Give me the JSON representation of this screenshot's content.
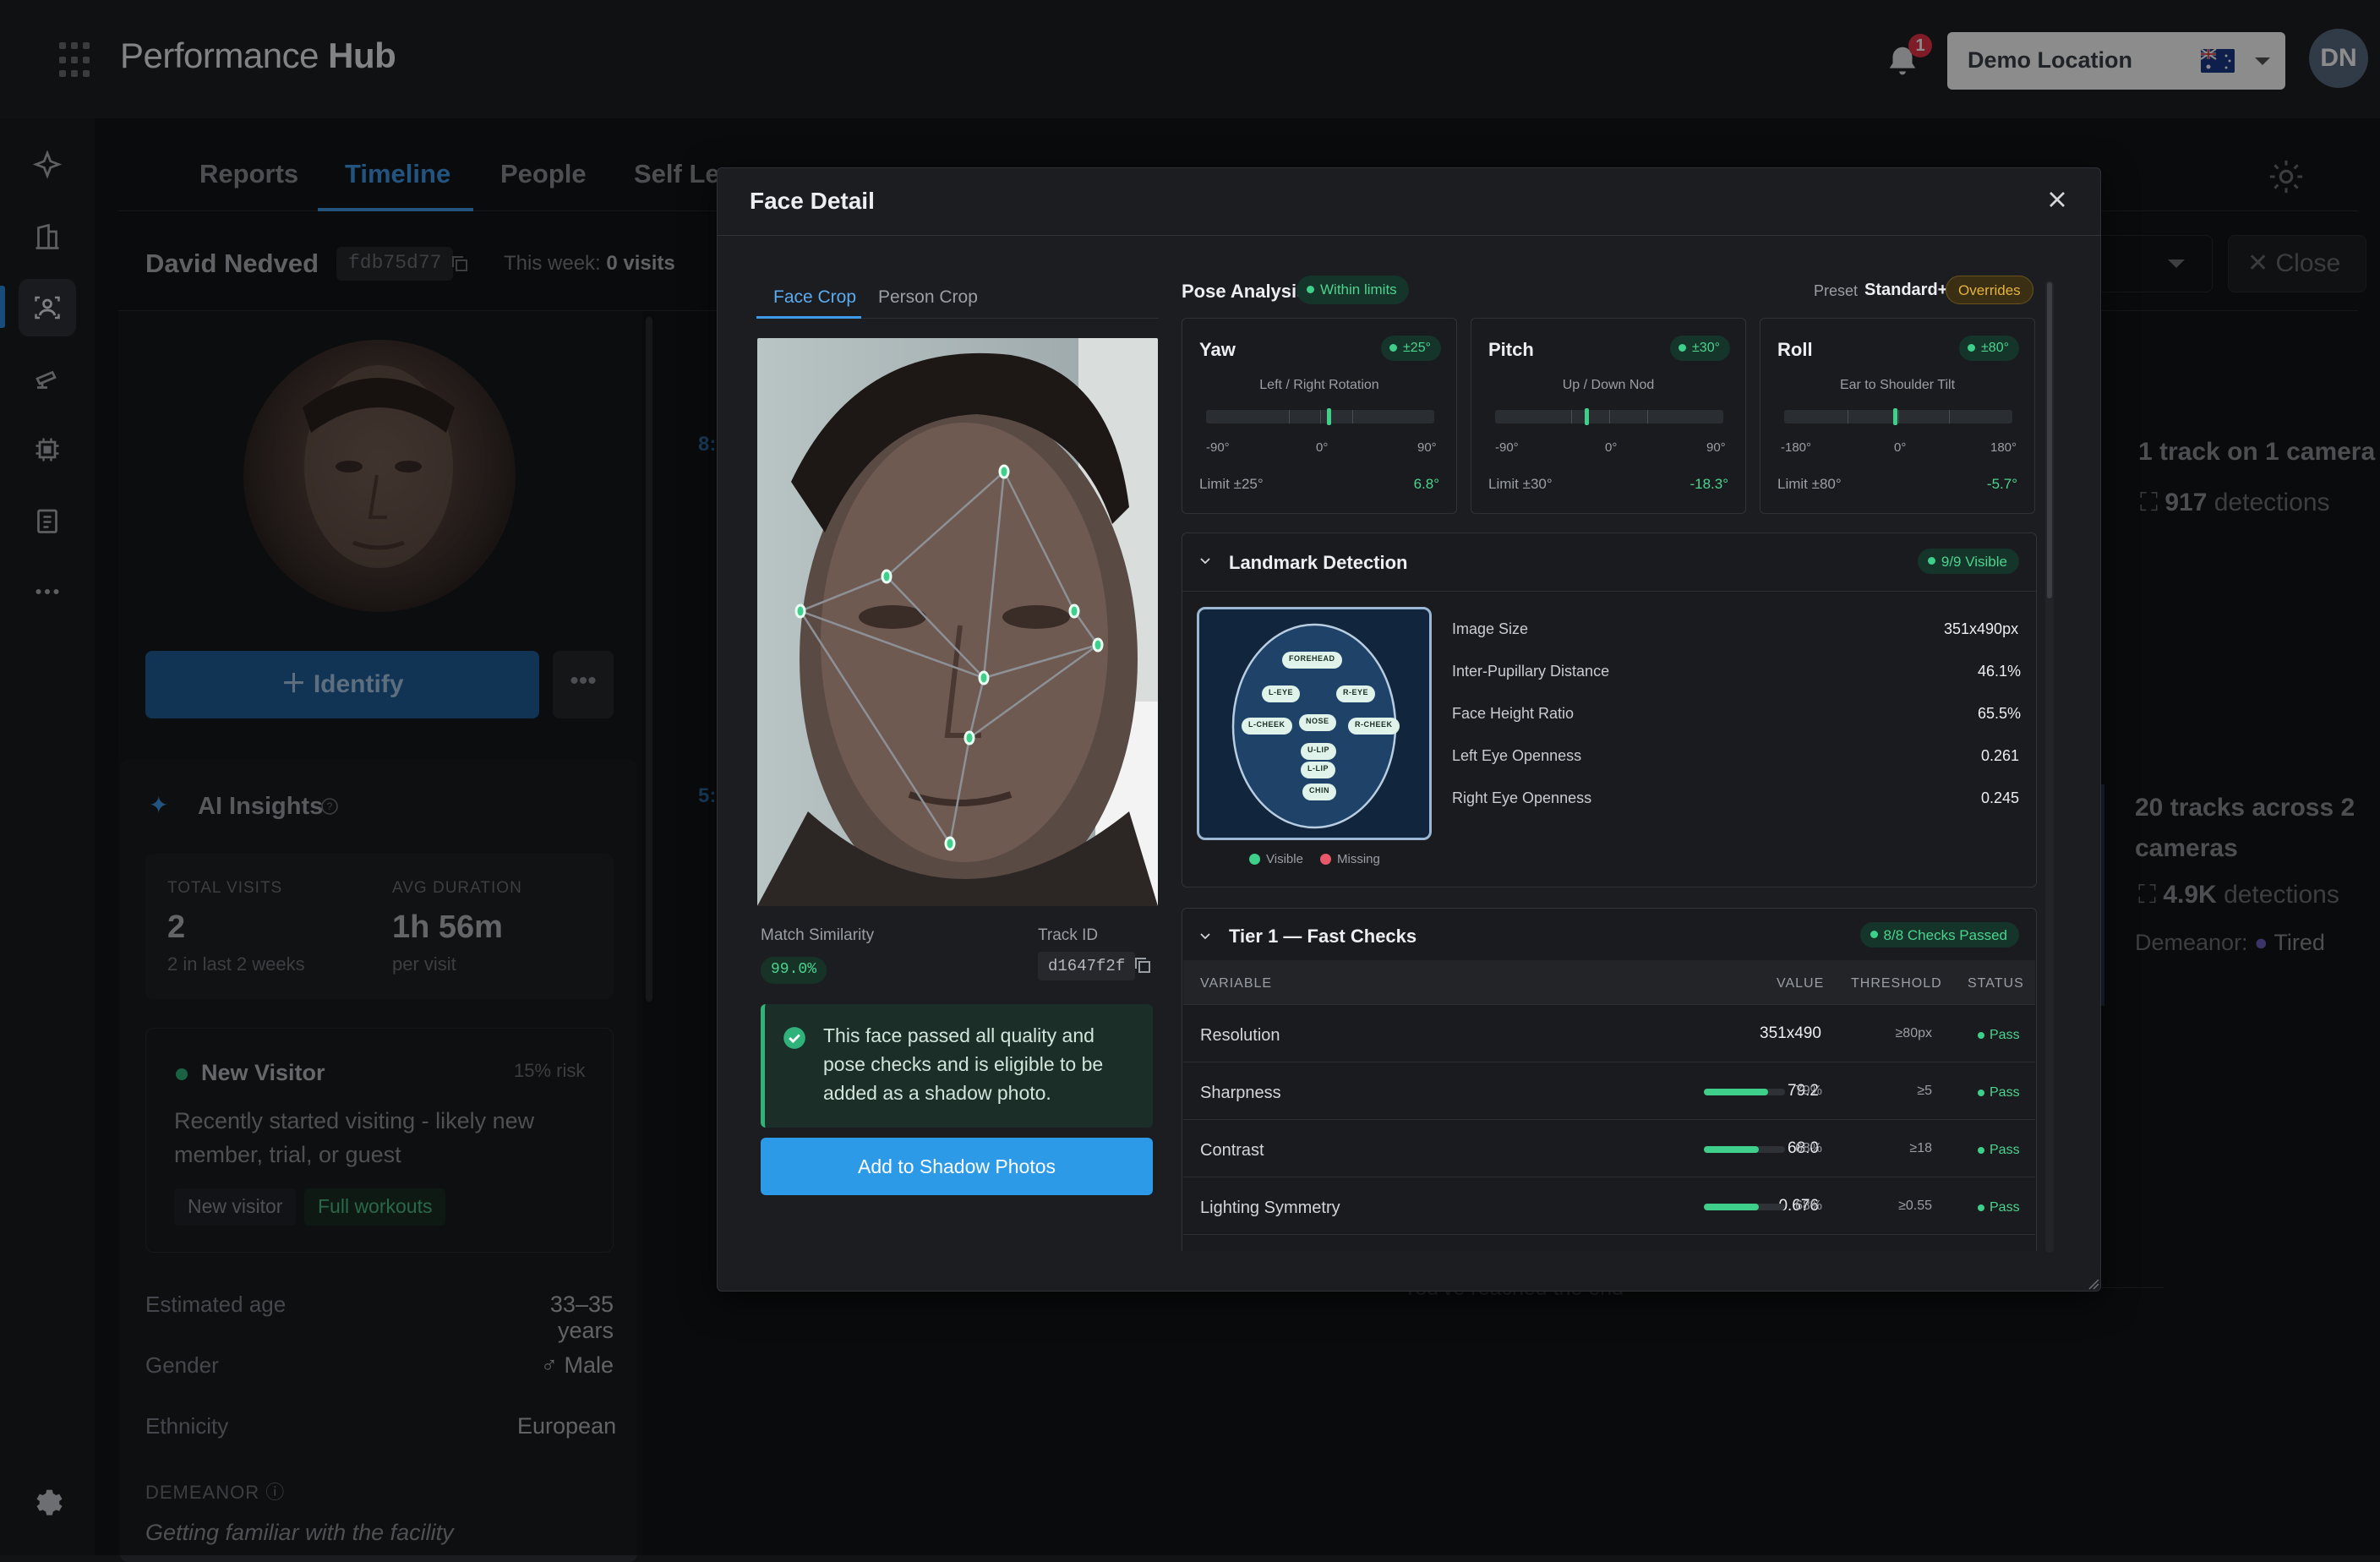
{
  "app": {
    "brand_light": "Performance ",
    "brand_bold": "Hub",
    "notification_count": "1",
    "location": "Demo Location",
    "user_initials": "DN"
  },
  "rail": {
    "icons": [
      "sparkle-icon",
      "building-icon",
      "people-icon",
      "camera-icon",
      "chip-icon",
      "clipboard-icon",
      "more-icon",
      "settings-icon"
    ],
    "active": "people-icon"
  },
  "page": {
    "tabs": [
      "Reports",
      "Timeline",
      "People",
      "Self Lea"
    ],
    "active_tab": "Timeline",
    "person": {
      "name": "David Nedved",
      "id": "fdb75d77",
      "week_prefix": "This week: ",
      "week_value": "0 visits"
    },
    "close_label": "Close",
    "identify_label": "Identify",
    "ai_insights_title": "AI Insights",
    "stats": {
      "visits_label": "TOTAL VISITS",
      "visits_value": "2",
      "visits_sub": "2 in last 2 weeks",
      "duration_label": "AVG DURATION",
      "duration_value": "1h 56m",
      "duration_sub": "per visit"
    },
    "visitor": {
      "title": "New Visitor",
      "risk": "15% risk",
      "desc": "Recently started visiting - likely new member, trial, or guest",
      "chips": [
        "New visitor",
        "Full workouts"
      ]
    },
    "info": [
      {
        "label": "Estimated age",
        "value": "33–35 years"
      },
      {
        "label": "Gender",
        "value": "♂ Male"
      },
      {
        "label": "Ethnicity",
        "value": "European"
      }
    ],
    "demeanor_label": "DEMEANOR",
    "demeanor_text": "Getting familiar with the facility",
    "timeline": {
      "frag1": "8:",
      "frag2": "5:",
      "stat1": "1 track on 1 camera",
      "stat1_num": "917",
      "stat1_unit": "detections",
      "stat2": "20 tracks across 2 cameras",
      "stat2_num": "4.9K",
      "stat2_unit": "detections",
      "demeanor_prefix": "Demeanor:",
      "demeanor_value": "Tired",
      "end_text": "You've reached the end"
    }
  },
  "modal": {
    "title": "Face Detail",
    "crop_tabs": [
      "Face Crop",
      "Person Crop"
    ],
    "active_crop_tab": "Face Crop",
    "match_label": "Match Similarity",
    "match_value": "99.0%",
    "track_label": "Track ID",
    "track_value": "d1647f2f",
    "pass_message": "This face passed all quality and pose checks and is eligible to be added as a shadow photo.",
    "shadow_button": "Add to Shadow Photos",
    "pose": {
      "title": "Pose Analysis",
      "status": "Within limits",
      "preset_label": "Preset",
      "preset_value": "Standard+",
      "overrides": "Overrides",
      "cards": [
        {
          "name": "Yaw",
          "limit_badge": "±25°",
          "sub": "Left / Right Rotation",
          "min": "-90°",
          "mid": "0°",
          "max": "90°",
          "limit_text": "Limit ±25°",
          "value_text": "6.8°",
          "value": 6.8,
          "range": [
            -90,
            90
          ],
          "limit": 25
        },
        {
          "name": "Pitch",
          "limit_badge": "±30°",
          "sub": "Up / Down Nod",
          "min": "-90°",
          "mid": "0°",
          "max": "90°",
          "limit_text": "Limit ±30°",
          "value_text": "-18.3°",
          "value": -18.3,
          "range": [
            -90,
            90
          ],
          "limit": 30
        },
        {
          "name": "Roll",
          "limit_badge": "±80°",
          "sub": "Ear to Shoulder Tilt",
          "min": "-180°",
          "mid": "0°",
          "max": "180°",
          "limit_text": "Limit ±80°",
          "value_text": "-5.7°",
          "value": -5.7,
          "range": [
            -180,
            180
          ],
          "limit": 80
        }
      ]
    },
    "landmark": {
      "title": "Landmark Detection",
      "badge": "9/9 Visible",
      "map_labels": [
        "FOREHEAD",
        "L-EYE",
        "R-EYE",
        "L-CHEEK",
        "NOSE",
        "R-CHEEK",
        "U-LIP",
        "L-LIP",
        "CHIN"
      ],
      "legend_visible": "Visible",
      "legend_missing": "Missing",
      "rows": [
        {
          "label": "Image Size",
          "value": "351x490px"
        },
        {
          "label": "Inter-Pupillary Distance",
          "value": "46.1%"
        },
        {
          "label": "Face Height Ratio",
          "value": "65.5%"
        },
        {
          "label": "Left Eye Openness",
          "value": "0.261"
        },
        {
          "label": "Right Eye Openness",
          "value": "0.245"
        }
      ]
    },
    "tier1": {
      "title": "Tier 1 — Fast Checks",
      "badge": "8/8 Checks Passed",
      "headers": [
        "VARIABLE",
        "VALUE",
        "THRESHOLD",
        "STATUS"
      ],
      "rows": [
        {
          "name": "Resolution",
          "value": "351x490",
          "pct": "",
          "pct_value": null,
          "threshold": "≥80px",
          "status": "Pass"
        },
        {
          "name": "Sharpness",
          "value": "79.2",
          "pct": "79%",
          "pct_value": 79,
          "threshold": "≥5",
          "status": "Pass"
        },
        {
          "name": "Contrast",
          "value": "68.0",
          "pct": "68%",
          "pct_value": 68,
          "threshold": "≥18",
          "status": "Pass"
        },
        {
          "name": "Lighting Symmetry",
          "value": "0.676",
          "pct": "68%",
          "pct_value": 68,
          "threshold": "≥0.55",
          "status": "Pass"
        }
      ]
    }
  },
  "colors": {
    "accent": "#3e9ae8",
    "pass": "#3ecf8a",
    "warning": "#e6b23c",
    "badge_red": "#e8344a"
  }
}
